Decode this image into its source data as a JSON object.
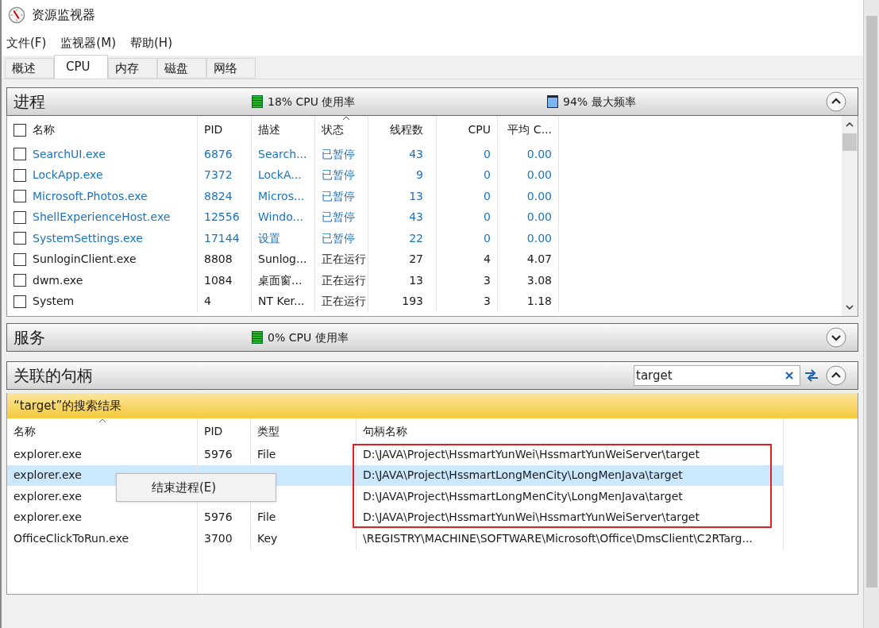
{
  "window": {
    "title": "资源监视器"
  },
  "menu": [
    "文件(F)",
    "监视器(M)",
    "帮助(H)"
  ],
  "tabs": [
    {
      "label": "概述",
      "selected": false
    },
    {
      "label": "CPU",
      "selected": true
    },
    {
      "label": "内存",
      "selected": false
    },
    {
      "label": "磁盘",
      "selected": false
    },
    {
      "label": "网络",
      "selected": false
    }
  ],
  "processes": {
    "title": "进程",
    "expanded": true,
    "all_checked": false,
    "stats": [
      {
        "kind": "cpu",
        "text": "18% CPU 使用率"
      },
      {
        "kind": "freq",
        "text": "94% 最大频率"
      }
    ],
    "columns": [
      "名称",
      "PID",
      "描述",
      "状态",
      "线程数",
      "CPU",
      "平均 C..."
    ],
    "rows": [
      {
        "checked": false,
        "suspended": true,
        "cells": [
          "SearchUI.exe",
          "6876",
          "Search...",
          "已暂停",
          "43",
          "0",
          "0.00"
        ]
      },
      {
        "checked": false,
        "suspended": true,
        "cells": [
          "LockApp.exe",
          "7372",
          "LockA...",
          "已暂停",
          "9",
          "0",
          "0.00"
        ]
      },
      {
        "checked": false,
        "suspended": true,
        "cells": [
          "Microsoft.Photos.exe",
          "8824",
          "Micros...",
          "已暂停",
          "13",
          "0",
          "0.00"
        ]
      },
      {
        "checked": false,
        "suspended": true,
        "cells": [
          "ShellExperienceHost.exe",
          "12556",
          "Windo...",
          "已暂停",
          "43",
          "0",
          "0.00"
        ]
      },
      {
        "checked": false,
        "suspended": true,
        "cells": [
          "SystemSettings.exe",
          "17144",
          "设置",
          "已暂停",
          "22",
          "0",
          "0.00"
        ]
      },
      {
        "checked": false,
        "suspended": false,
        "cells": [
          "SunloginClient.exe",
          "8808",
          "Sunlog...",
          "正在运行",
          "27",
          "4",
          "4.07"
        ]
      },
      {
        "checked": false,
        "suspended": false,
        "cells": [
          "dwm.exe",
          "1084",
          "桌面窗...",
          "正在运行",
          "13",
          "3",
          "3.08"
        ]
      },
      {
        "checked": false,
        "suspended": false,
        "cells": [
          "System",
          "4",
          "NT Ker...",
          "正在运行",
          "193",
          "3",
          "1.18"
        ]
      }
    ]
  },
  "services": {
    "title": "服务",
    "expanded": false,
    "stats": [
      {
        "kind": "cpu",
        "text": "0% CPU 使用率"
      }
    ]
  },
  "handles": {
    "title": "关联的句柄",
    "expanded": true,
    "search": {
      "value": "target"
    },
    "banner": "“target”的搜索结果",
    "columns": [
      "名称",
      "PID",
      "类型",
      "句柄名称"
    ],
    "rows": [
      {
        "selected": false,
        "annotated": true,
        "name": "explorer.exe",
        "pid": "5976",
        "type": "File",
        "handle": "D:\\JAVA\\Project\\HssmartYunWei\\HssmartYunWeiServer\\target"
      },
      {
        "selected": true,
        "annotated": true,
        "name": "explorer.exe",
        "handle": "D:\\JAVA\\Project\\HssmartLongMenCity\\LongMenJava\\target"
      },
      {
        "selected": false,
        "annotated": true,
        "name": "explorer.exe",
        "handle": "D:\\JAVA\\Project\\HssmartLongMenCity\\LongMenJava\\target"
      },
      {
        "selected": false,
        "annotated": true,
        "name": "explorer.exe",
        "pid": "5976",
        "type": "File",
        "handle": "D:\\JAVA\\Project\\HssmartYunWei\\HssmartYunWeiServer\\target"
      },
      {
        "selected": false,
        "annotated": false,
        "name": "OfficeClickToRun.exe",
        "pid": "3700",
        "type": "Key",
        "handle": "\\REGISTRY\\MACHINE\\SOFTWARE\\Microsoft\\Office\\DmsClient\\C2RTarg..."
      }
    ],
    "context_menu": {
      "items": [
        "结束进程(E)"
      ]
    }
  }
}
